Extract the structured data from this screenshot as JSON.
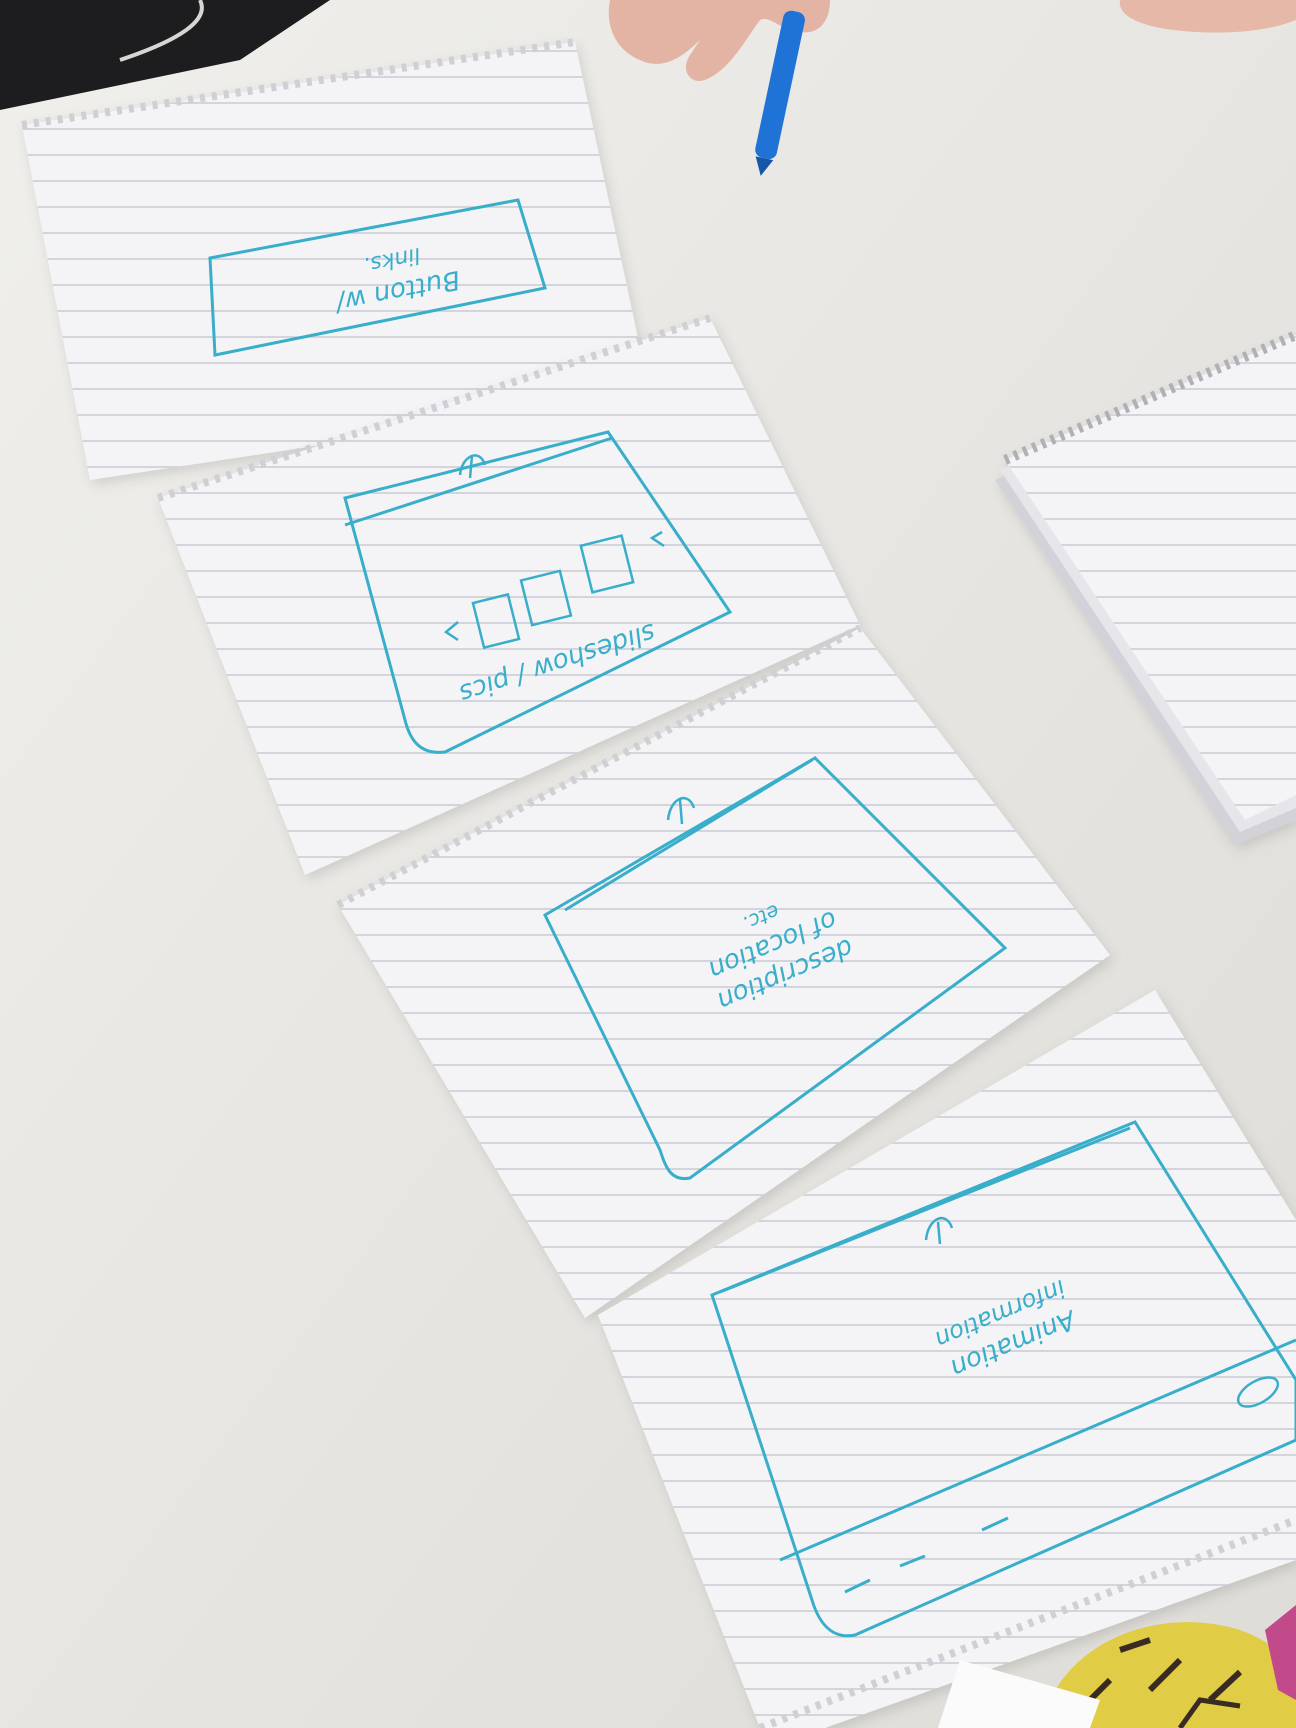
{
  "photo": {
    "description_tags": [
      "paper-prototype",
      "sketches",
      "notepad-pages",
      "table"
    ]
  },
  "sheets": [
    {
      "lines": [
        "Button w/",
        "links."
      ]
    },
    {
      "lines": [
        "slideshow / pics"
      ]
    },
    {
      "lines": [
        "description",
        "of location",
        "etc."
      ]
    },
    {
      "lines": [
        "Animation",
        "information"
      ]
    }
  ],
  "colors": {
    "table": "#e9e7e2",
    "paper": "#f4f4f6",
    "rule_line": "#c9cad4",
    "ink": "#39aecb",
    "marker_body": "#1f73d6"
  }
}
